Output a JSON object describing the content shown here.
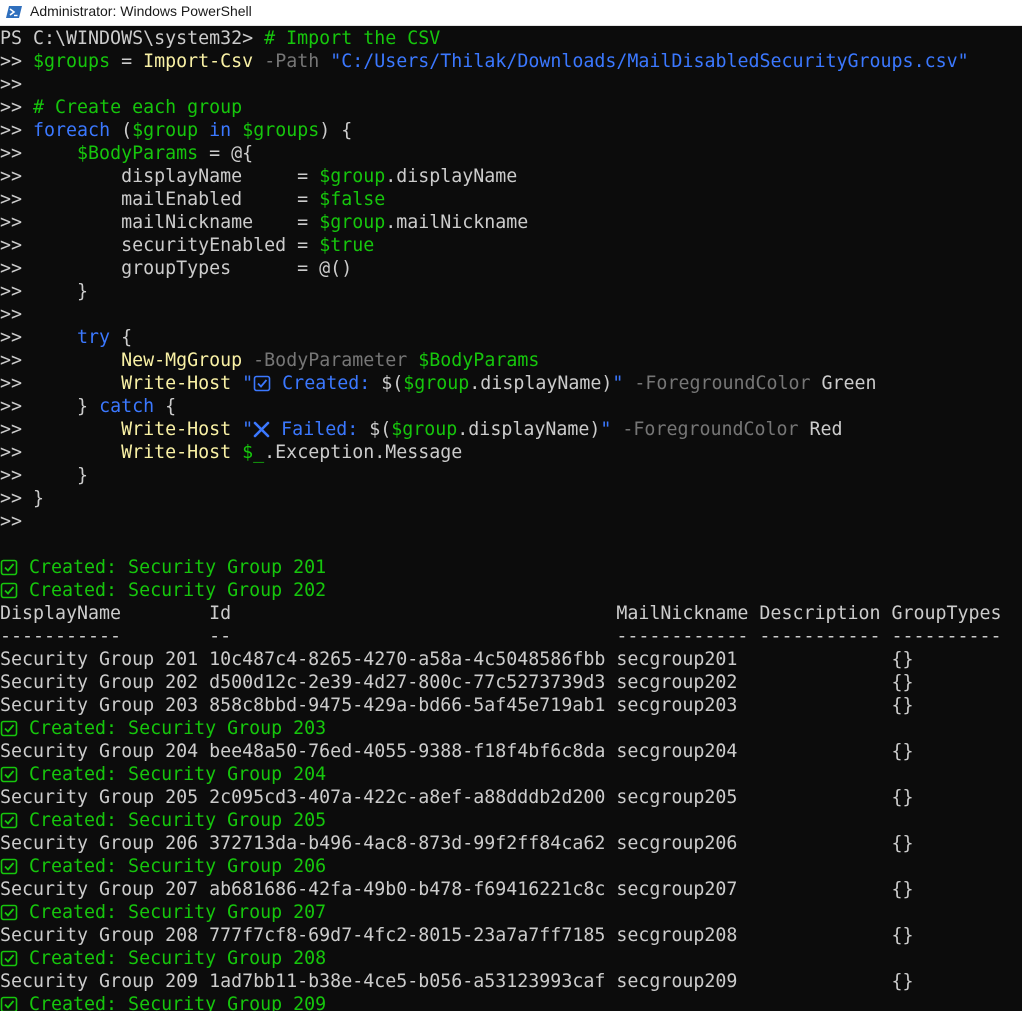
{
  "window": {
    "title": "Administrator: Windows PowerShell"
  },
  "icons": {
    "app": "powershell-icon",
    "check": "check-box-icon",
    "cross": "cross-mark-icon"
  },
  "colors": {
    "background": "#0c0c0c",
    "default": "#cccccc",
    "green": "#16c60c",
    "command": "#f9f1a5",
    "parameter": "#767676",
    "string": "#3b78ff"
  },
  "lines": [
    [
      [
        "c-def",
        "PS C:\\WINDOWS\\system32> "
      ],
      [
        "c-cmt",
        "# Import the CSV"
      ]
    ],
    [
      [
        "c-def",
        ">> "
      ],
      [
        "c-var",
        "$groups"
      ],
      [
        "c-def",
        " = "
      ],
      [
        "c-cmd",
        "Import-Csv"
      ],
      [
        "c-def",
        " "
      ],
      [
        "c-param",
        "-Path"
      ],
      [
        "c-def",
        " "
      ],
      [
        "c-str",
        "\"C:/Users/Thilak/Downloads/MailDisabledSecurityGroups.csv\""
      ]
    ],
    [
      [
        "c-def",
        ">>"
      ]
    ],
    [
      [
        "c-def",
        ">> "
      ],
      [
        "c-cmt",
        "# Create each group"
      ]
    ],
    [
      [
        "c-def",
        ">> "
      ],
      [
        "c-kw",
        "foreach"
      ],
      [
        "c-def",
        " ("
      ],
      [
        "c-var",
        "$group"
      ],
      [
        "c-def",
        " "
      ],
      [
        "c-kw",
        "in"
      ],
      [
        "c-def",
        " "
      ],
      [
        "c-var",
        "$groups"
      ],
      [
        "c-def",
        ") {"
      ]
    ],
    [
      [
        "c-def",
        ">>     "
      ],
      [
        "c-var",
        "$BodyParams"
      ],
      [
        "c-def",
        " = @{"
      ]
    ],
    [
      [
        "c-def",
        ">>         displayName     = "
      ],
      [
        "c-var",
        "$group"
      ],
      [
        "c-def",
        ".displayName"
      ]
    ],
    [
      [
        "c-def",
        ">>         mailEnabled     = "
      ],
      [
        "c-var",
        "$false"
      ]
    ],
    [
      [
        "c-def",
        ">>         mailNickname    = "
      ],
      [
        "c-var",
        "$group"
      ],
      [
        "c-def",
        ".mailNickname"
      ]
    ],
    [
      [
        "c-def",
        ">>         securityEnabled = "
      ],
      [
        "c-var",
        "$true"
      ]
    ],
    [
      [
        "c-def",
        ">>         groupTypes      = @()"
      ]
    ],
    [
      [
        "c-def",
        ">>     }"
      ]
    ],
    [
      [
        "c-def",
        ">>"
      ]
    ],
    [
      [
        "c-def",
        ">>     "
      ],
      [
        "c-kw",
        "try"
      ],
      [
        "c-def",
        " {"
      ]
    ],
    [
      [
        "c-def",
        ">>         "
      ],
      [
        "c-cmd",
        "New-MgGroup"
      ],
      [
        "c-def",
        " "
      ],
      [
        "c-param",
        "-BodyParameter"
      ],
      [
        "c-def",
        " "
      ],
      [
        "c-var",
        "$BodyParams"
      ]
    ],
    [
      [
        "c-def",
        ">>         "
      ],
      [
        "c-cmd",
        "Write-Host"
      ],
      [
        "c-def",
        " "
      ],
      [
        "c-str",
        "\""
      ],
      [
        "icon",
        "check"
      ],
      [
        "c-str",
        " Created: "
      ],
      [
        "c-def",
        "$("
      ],
      [
        "c-var",
        "$group"
      ],
      [
        "c-def",
        ".displayName)"
      ],
      [
        "c-str",
        "\""
      ],
      [
        "c-def",
        " "
      ],
      [
        "c-param",
        "-ForegroundColor"
      ],
      [
        "c-def",
        " Green"
      ]
    ],
    [
      [
        "c-def",
        ">>     } "
      ],
      [
        "c-kw",
        "catch"
      ],
      [
        "c-def",
        " {"
      ]
    ],
    [
      [
        "c-def",
        ">>         "
      ],
      [
        "c-cmd",
        "Write-Host"
      ],
      [
        "c-def",
        " "
      ],
      [
        "c-str",
        "\""
      ],
      [
        "icon",
        "cross"
      ],
      [
        "c-str",
        " Failed: "
      ],
      [
        "c-def",
        "$("
      ],
      [
        "c-var",
        "$group"
      ],
      [
        "c-def",
        ".displayName)"
      ],
      [
        "c-str",
        "\""
      ],
      [
        "c-def",
        " "
      ],
      [
        "c-param",
        "-ForegroundColor"
      ],
      [
        "c-def",
        " Red"
      ]
    ],
    [
      [
        "c-def",
        ">>         "
      ],
      [
        "c-cmd",
        "Write-Host"
      ],
      [
        "c-def",
        " "
      ],
      [
        "c-var",
        "$_"
      ],
      [
        "c-def",
        ".Exception.Message"
      ]
    ],
    [
      [
        "c-def",
        ">>     }"
      ]
    ],
    [
      [
        "c-def",
        ">> }"
      ]
    ],
    [
      [
        "c-def",
        ">>"
      ]
    ],
    [
      [
        "c-def",
        ""
      ]
    ],
    [
      [
        "icon",
        "check"
      ],
      [
        "c-grn",
        " Created: Security Group 201"
      ]
    ],
    [
      [
        "icon",
        "check"
      ],
      [
        "c-grn",
        " Created: Security Group 202"
      ]
    ],
    [
      [
        "c-def",
        "DisplayName        Id                                   MailNickname Description GroupTypes"
      ]
    ],
    [
      [
        "c-def",
        "-----------        --                                   ------------ ----------- ----------"
      ]
    ],
    [
      [
        "c-def",
        "Security Group 201 10c487c4-8265-4270-a58a-4c5048586fbb secgroup201              {}"
      ]
    ],
    [
      [
        "c-def",
        "Security Group 202 d500d12c-2e39-4d27-800c-77c5273739d3 secgroup202              {}"
      ]
    ],
    [
      [
        "c-def",
        "Security Group 203 858c8bbd-9475-429a-bd66-5af45e719ab1 secgroup203              {}"
      ]
    ],
    [
      [
        "icon",
        "check"
      ],
      [
        "c-grn",
        " Created: Security Group 203"
      ]
    ],
    [
      [
        "c-def",
        "Security Group 204 bee48a50-76ed-4055-9388-f18f4bf6c8da secgroup204              {}"
      ]
    ],
    [
      [
        "icon",
        "check"
      ],
      [
        "c-grn",
        " Created: Security Group 204"
      ]
    ],
    [
      [
        "c-def",
        "Security Group 205 2c095cd3-407a-422c-a8ef-a88dddb2d200 secgroup205              {}"
      ]
    ],
    [
      [
        "icon",
        "check"
      ],
      [
        "c-grn",
        " Created: Security Group 205"
      ]
    ],
    [
      [
        "c-def",
        "Security Group 206 372713da-b496-4ac8-873d-99f2ff84ca62 secgroup206              {}"
      ]
    ],
    [
      [
        "icon",
        "check"
      ],
      [
        "c-grn",
        " Created: Security Group 206"
      ]
    ],
    [
      [
        "c-def",
        "Security Group 207 ab681686-42fa-49b0-b478-f69416221c8c secgroup207              {}"
      ]
    ],
    [
      [
        "icon",
        "check"
      ],
      [
        "c-grn",
        " Created: Security Group 207"
      ]
    ],
    [
      [
        "c-def",
        "Security Group 208 777f7cf8-69d7-4fc2-8015-23a7a7ff7185 secgroup208              {}"
      ]
    ],
    [
      [
        "icon",
        "check"
      ],
      [
        "c-grn",
        " Created: Security Group 208"
      ]
    ],
    [
      [
        "c-def",
        "Security Group 209 1ad7bb11-b38e-4ce5-b056-a53123993caf secgroup209              {}"
      ]
    ],
    [
      [
        "icon",
        "check"
      ],
      [
        "c-grn",
        " Created: Security Group 209"
      ]
    ]
  ]
}
